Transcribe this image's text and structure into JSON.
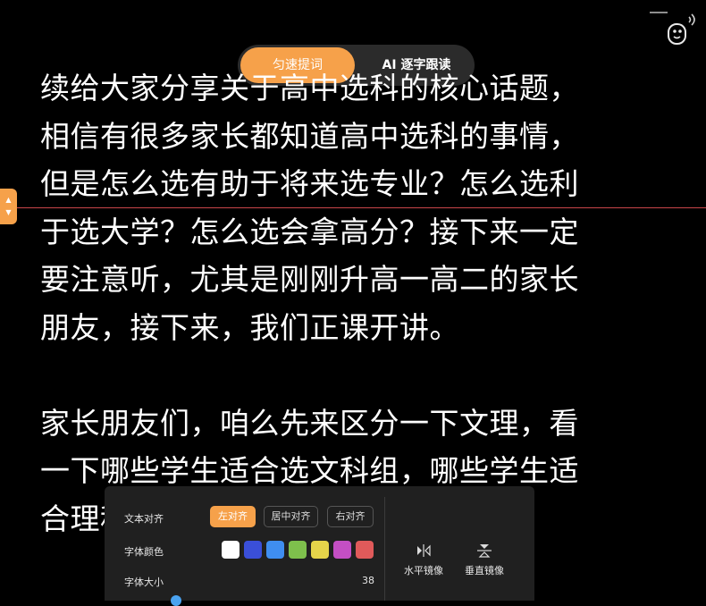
{
  "colors": {
    "accent": "#f6a14a",
    "background": "#000000",
    "panel": "#202020",
    "guide_line": "#c8454a"
  },
  "modes": {
    "active_label": "匀速提词",
    "ai_label": "AI 逐字跟读"
  },
  "prompt": {
    "paragraphs": [
      "续给大家分享关于高中选科的核心话题，",
      "相信有很多家长都知道高中选科的事情，",
      "但是怎么选有助于将来选专业？怎么选利",
      "于选大学？怎么选会拿高分？接下来一定",
      "要注意听，尤其是刚刚升高一高二的家长",
      "朋友，接下来，我们正课开讲。",
      "",
      "家长朋友们，咱么先来区分一下文理，看",
      "一下哪些学生适合选文科组，哪些学生适",
      "合理科组"
    ]
  },
  "settings": {
    "align_label": "文本对齐",
    "align_options": [
      "左对齐",
      "居中对齐",
      "右对齐"
    ],
    "align_selected": "左对齐",
    "color_label": "字体颜色",
    "font_colors": [
      "#ffffff",
      "#3a4fd8",
      "#3f8ef0",
      "#7ec04c",
      "#e6d44a",
      "#c44fc4",
      "#e05a5a"
    ],
    "size_label": "字体大小",
    "size_value": "38",
    "mirror_h_label": "水平镜像",
    "mirror_v_label": "垂直镜像"
  },
  "icons": {
    "app": "microphone-robot-icon",
    "mirror_h": "horizontal-mirror-icon",
    "mirror_v": "vertical-mirror-icon",
    "handle": "chevron-up-down-icon"
  }
}
